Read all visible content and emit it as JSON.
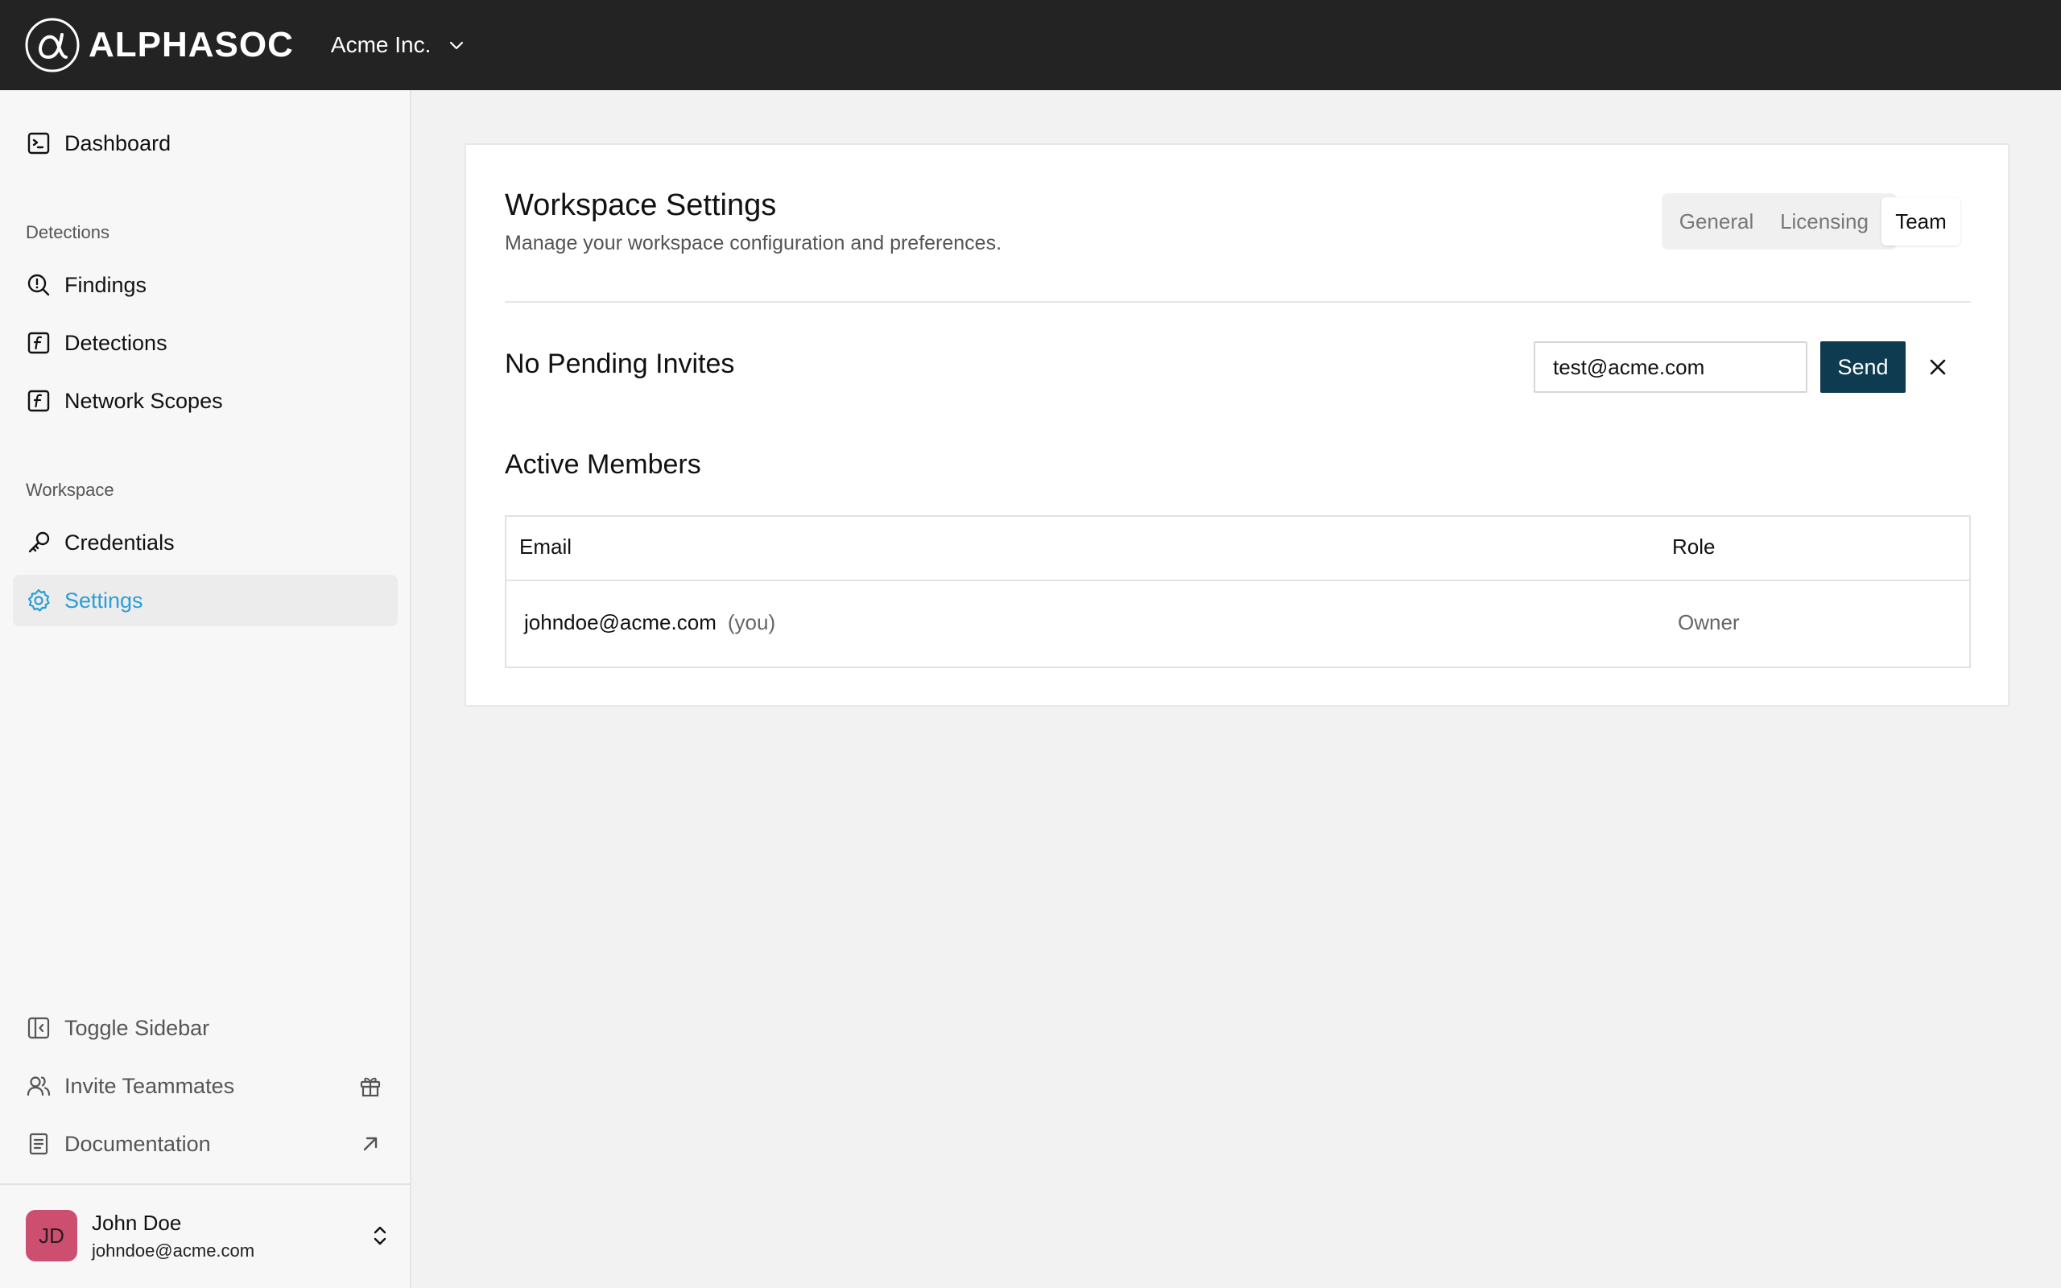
{
  "brand": {
    "name": "ALPHASOC"
  },
  "org_switcher": {
    "label": "Acme Inc."
  },
  "sidebar": {
    "dashboard": "Dashboard",
    "sections": [
      {
        "label": "Detections",
        "items": [
          "Findings",
          "Detections",
          "Network Scopes"
        ]
      },
      {
        "label": "Workspace",
        "items": [
          "Credentials",
          "Settings"
        ]
      }
    ],
    "active_item": "Settings",
    "footer_items": [
      "Toggle Sidebar",
      "Invite Teammates",
      "Documentation"
    ]
  },
  "user": {
    "initials": "JD",
    "name": "John Doe",
    "email": "johndoe@acme.com",
    "avatar_color": "#cc4f6f"
  },
  "page": {
    "title": "Workspace Settings",
    "subtitle": "Manage your workspace configuration and preferences.",
    "tabs": [
      "General",
      "Licensing",
      "Team"
    ],
    "active_tab": "Team"
  },
  "invites": {
    "title": "No Pending Invites",
    "input_value": "test@acme.com",
    "send_label": "Send"
  },
  "members": {
    "title": "Active Members",
    "columns": [
      "Email",
      "Role"
    ],
    "rows": [
      {
        "email": "johndoe@acme.com",
        "tag": "(you)",
        "role": "Owner"
      }
    ]
  },
  "colors": {
    "accent": "#2a9ed6",
    "topbar": "#232323",
    "send_button": "#0e3b4f"
  }
}
